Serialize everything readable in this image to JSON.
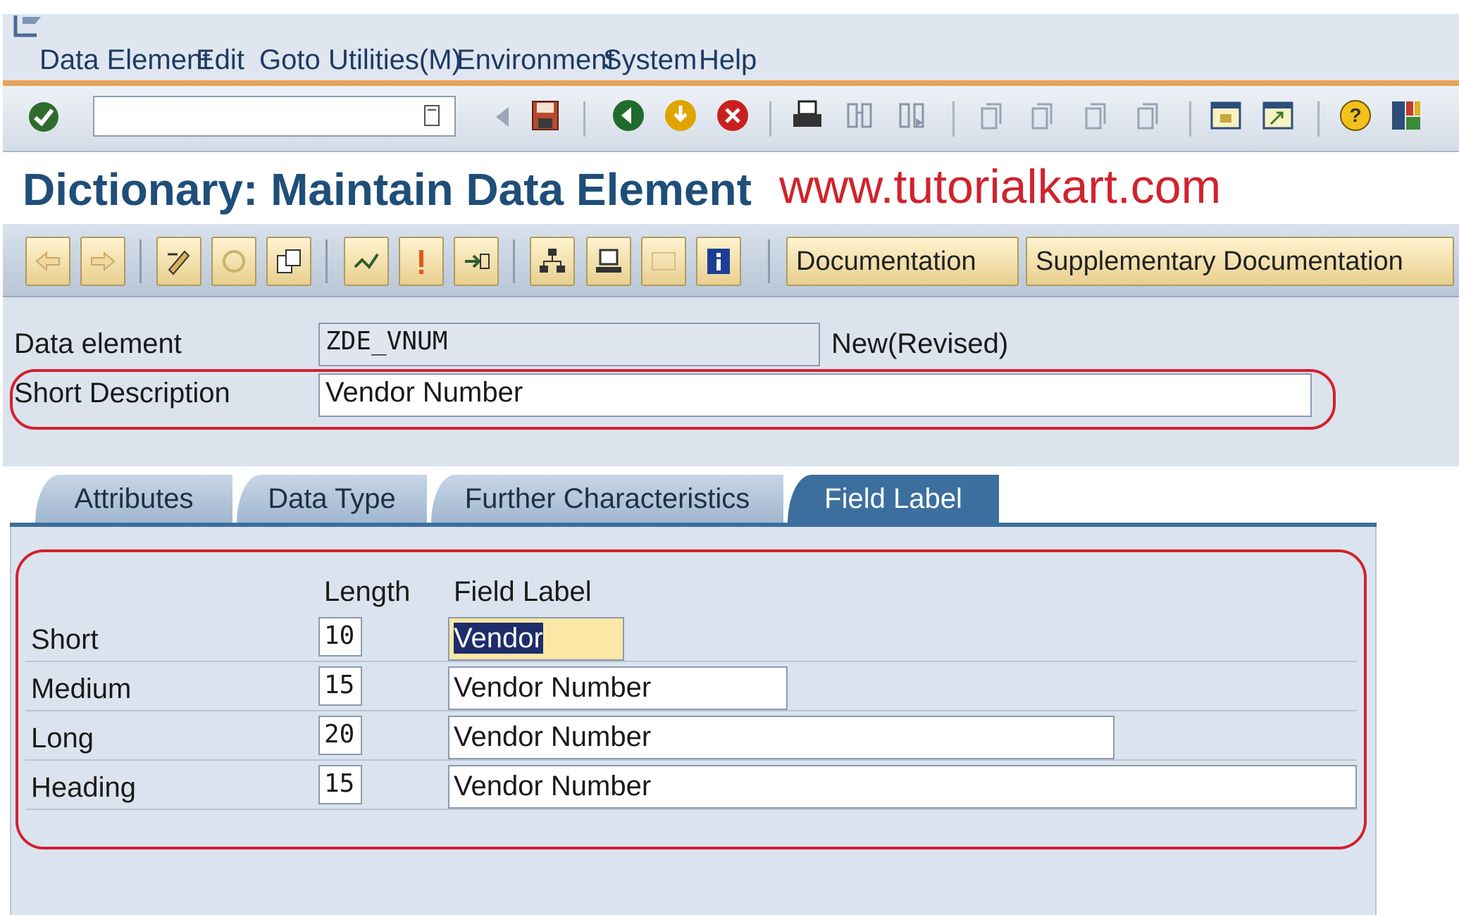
{
  "menubar": {
    "items": [
      "Data Element",
      "Edit",
      "Goto",
      "Utilities(M)",
      "Environment",
      "System",
      "Help"
    ]
  },
  "toolbar": {
    "command_value": "",
    "icons": [
      "enter-icon",
      "command-dropdown-icon",
      "back-arrow-icon",
      "save-icon",
      "back-icon",
      "exit-icon",
      "cancel-icon",
      "print-icon",
      "find-icon",
      "find-next-icon",
      "first-page-icon",
      "previous-page-icon",
      "next-page-icon",
      "last-page-icon",
      "create-session-icon",
      "shortcut-icon",
      "help-icon",
      "layout-icon"
    ]
  },
  "title": {
    "text": "Dictionary: Maintain Data Element",
    "watermark": "www.tutorialkart.com"
  },
  "app_toolbar": {
    "icons": [
      "back-arrow-icon",
      "forward-arrow-icon",
      "display-change-icon",
      "other-object-icon",
      "activate-icon",
      "check-icon",
      "where-used-icon",
      "where-used-list-icon",
      "object-list-icon",
      "navigation-window-icon",
      "display-object-list-icon",
      "info-icon"
    ],
    "documentation_label": "Documentation",
    "supplementary_label": "Supplementary Documentation"
  },
  "header": {
    "data_element_label": "Data element",
    "data_element_value": "ZDE_VNUM",
    "status": "New(Revised)",
    "short_description_label": "Short Description",
    "short_description_value": "Vendor Number"
  },
  "tabs": [
    {
      "label": "Attributes",
      "active": false
    },
    {
      "label": "Data Type",
      "active": false
    },
    {
      "label": "Further Characteristics",
      "active": false
    },
    {
      "label": "Field Label",
      "active": true
    }
  ],
  "field_labels": {
    "length_header": "Length",
    "label_header": "Field Label",
    "rows": [
      {
        "name": "Short",
        "length": "10",
        "label": "Vendor"
      },
      {
        "name": "Medium",
        "length": "15",
        "label": "Vendor Number"
      },
      {
        "name": "Long",
        "length": "20",
        "label": "Vendor Number"
      },
      {
        "name": "Heading",
        "length": "15",
        "label": "Vendor Number"
      }
    ]
  },
  "colors": {
    "accent": "#1f4e79",
    "highlight_outline": "#d32030",
    "active_tab": "#3c6f9e",
    "watermark": "#d0232d"
  }
}
